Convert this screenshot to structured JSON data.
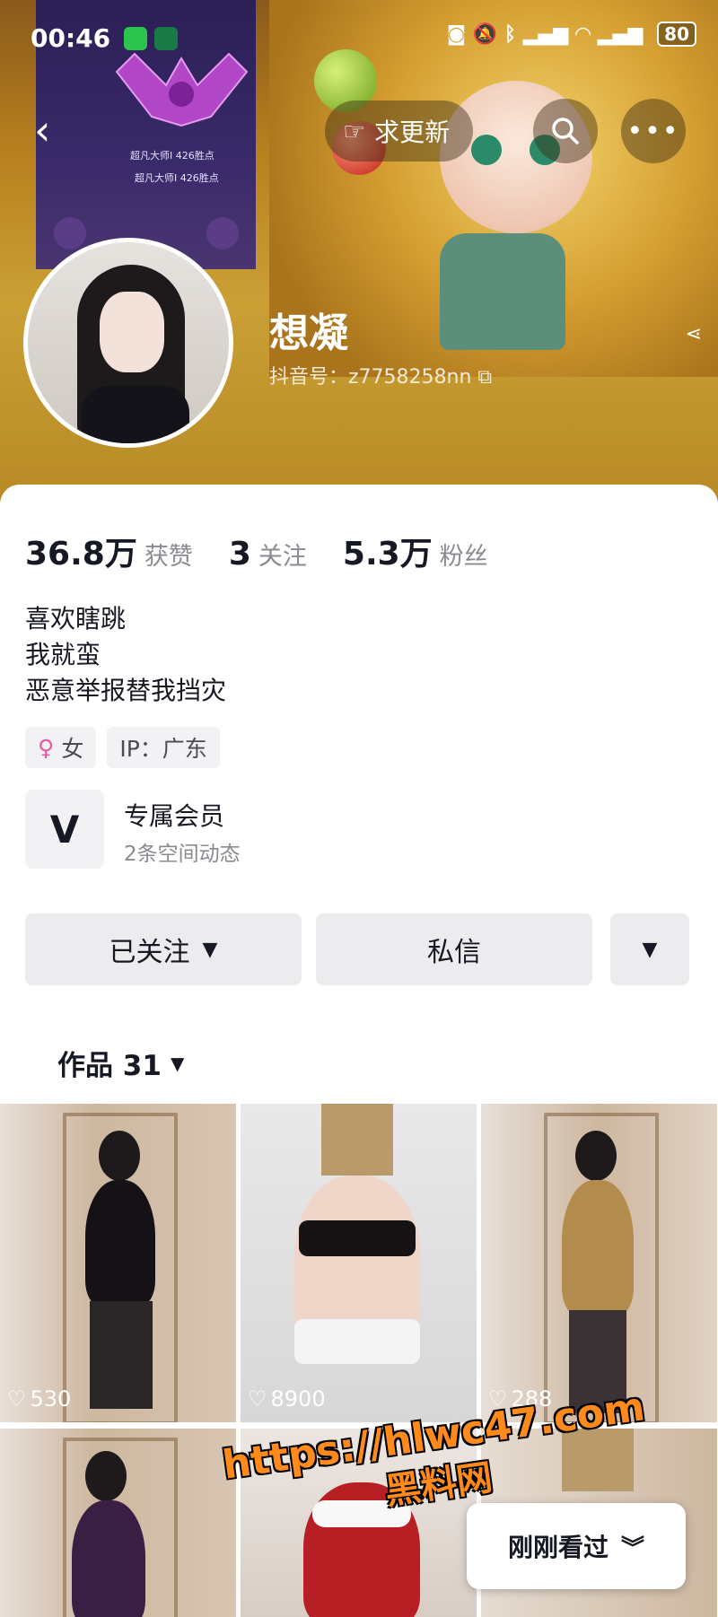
{
  "status_bar": {
    "time": "00:46",
    "battery": "80"
  },
  "header": {
    "update_label": "求更新",
    "nickname": "想凝",
    "douyin_id": "抖音号：z7758258nn",
    "rank_title_1": "超凡大师I 426胜点",
    "rank_title_2": "超凡大师I 426胜点"
  },
  "stats": [
    {
      "value": "36.8万",
      "label": "获赞"
    },
    {
      "value": "3",
      "label": "关注"
    },
    {
      "value": "5.3万",
      "label": "粉丝"
    }
  ],
  "bio": [
    "喜欢瞎跳",
    "我就蛮",
    "恶意举报替我挡灾"
  ],
  "tags": {
    "gender": "女",
    "ip": "IP：广东"
  },
  "member": {
    "title": "专属会员",
    "subtitle": "2条空间动态"
  },
  "actions": {
    "followed_label": "已关注",
    "message_label": "私信"
  },
  "works": {
    "label": "作品 31"
  },
  "videos": [
    {
      "likes": "530"
    },
    {
      "likes": "8900"
    },
    {
      "likes": "288"
    }
  ],
  "watermark": {
    "url": "https://hlwc47.com",
    "name": "黑料网"
  },
  "recently_viewed": {
    "label": "刚刚看过"
  },
  "colors": {
    "header_gold": "#b7801e",
    "pink_gender": "#e85aa0",
    "watermark_orange": "#ff8a1c"
  }
}
